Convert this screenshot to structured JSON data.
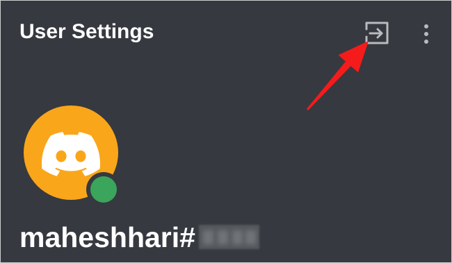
{
  "theme": {
    "background": "#36393f",
    "text_color": "#ffffff",
    "icon_color": "#b9bbbe"
  },
  "header": {
    "title": "User Settings",
    "logout_icon": "logout-icon",
    "more_icon": "more-vertical-icon"
  },
  "annotation": {
    "arrow_color": "#f51b1b"
  },
  "profile": {
    "avatar_icon": "discord-logo-icon",
    "avatar_color": "#faa61a",
    "avatar_logo_color": "#ffffff",
    "status_color": "#3ba55c",
    "username": "maheshhari#"
  }
}
